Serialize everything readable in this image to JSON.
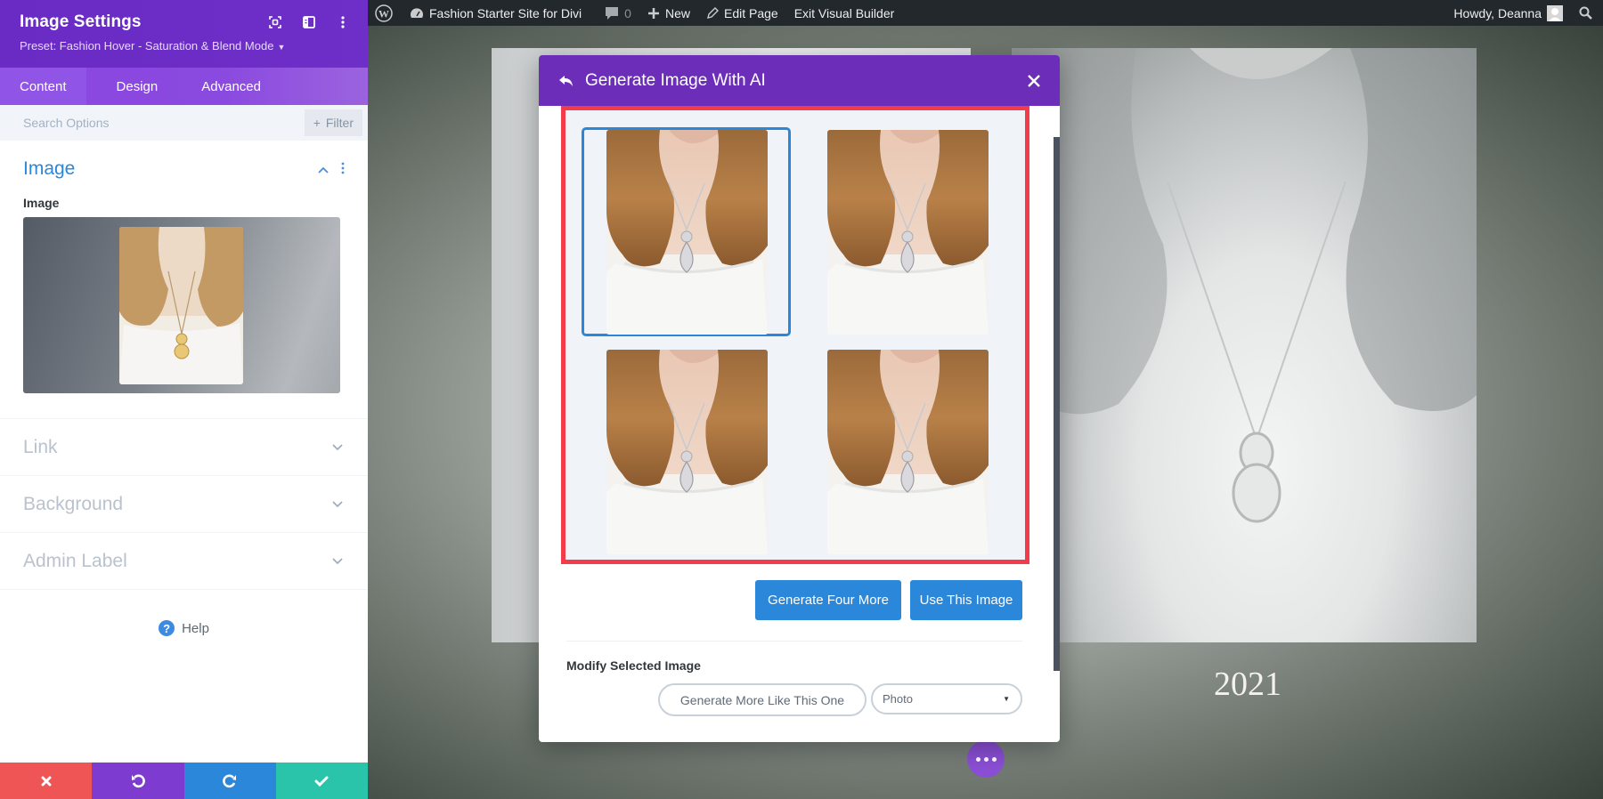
{
  "panel": {
    "title": "Image Settings",
    "preset": "Preset: Fashion Hover - Saturation & Blend Mode",
    "header_icons": [
      "focus-icon",
      "sidebar-toggle-icon",
      "more-vertical-icon"
    ],
    "tabs": [
      {
        "label": "Content",
        "active": true
      },
      {
        "label": "Design",
        "active": false
      },
      {
        "label": "Advanced",
        "active": false
      }
    ],
    "search_placeholder": "Search Options",
    "filter_label": "Filter",
    "image_section": {
      "title": "Image",
      "field_label": "Image",
      "expanded": true
    },
    "collapsed_sections": [
      {
        "label": "Link"
      },
      {
        "label": "Background"
      },
      {
        "label": "Admin Label"
      }
    ],
    "help_label": "Help",
    "footer": {
      "discard": "discard",
      "undo": "undo",
      "redo": "redo",
      "save": "save"
    }
  },
  "adminbar": {
    "site_name": "Fashion Starter Site for Divi",
    "comments_count": "0",
    "new_label": "New",
    "edit_page_label": "Edit Page",
    "exit_builder_label": "Exit Visual Builder",
    "greeting": "Howdy, Deanna"
  },
  "page": {
    "year": "2021"
  },
  "modal": {
    "title": "Generate Image With AI",
    "results": [
      {
        "id": "result-1",
        "selected": true,
        "pendant": "teardrop"
      },
      {
        "id": "result-2",
        "selected": false,
        "pendant": "teardrop"
      },
      {
        "id": "result-3",
        "selected": false,
        "pendant": "teardrop"
      },
      {
        "id": "result-4",
        "selected": false,
        "pendant": "teardrop"
      }
    ],
    "generate_four_more": "Generate Four More",
    "use_this_image": "Use This Image",
    "modify_label": "Modify Selected Image",
    "generate_more_like": "Generate More Like This One",
    "style_select": {
      "selected": "Photo"
    }
  },
  "colors": {
    "panel_purple": "#6a2bc4",
    "tab_purple": "#8a47e0",
    "accent_blue": "#2b87da",
    "highlight_red": "#f23c4b",
    "discard_red": "#ef5555",
    "save_green": "#29c4a9"
  }
}
